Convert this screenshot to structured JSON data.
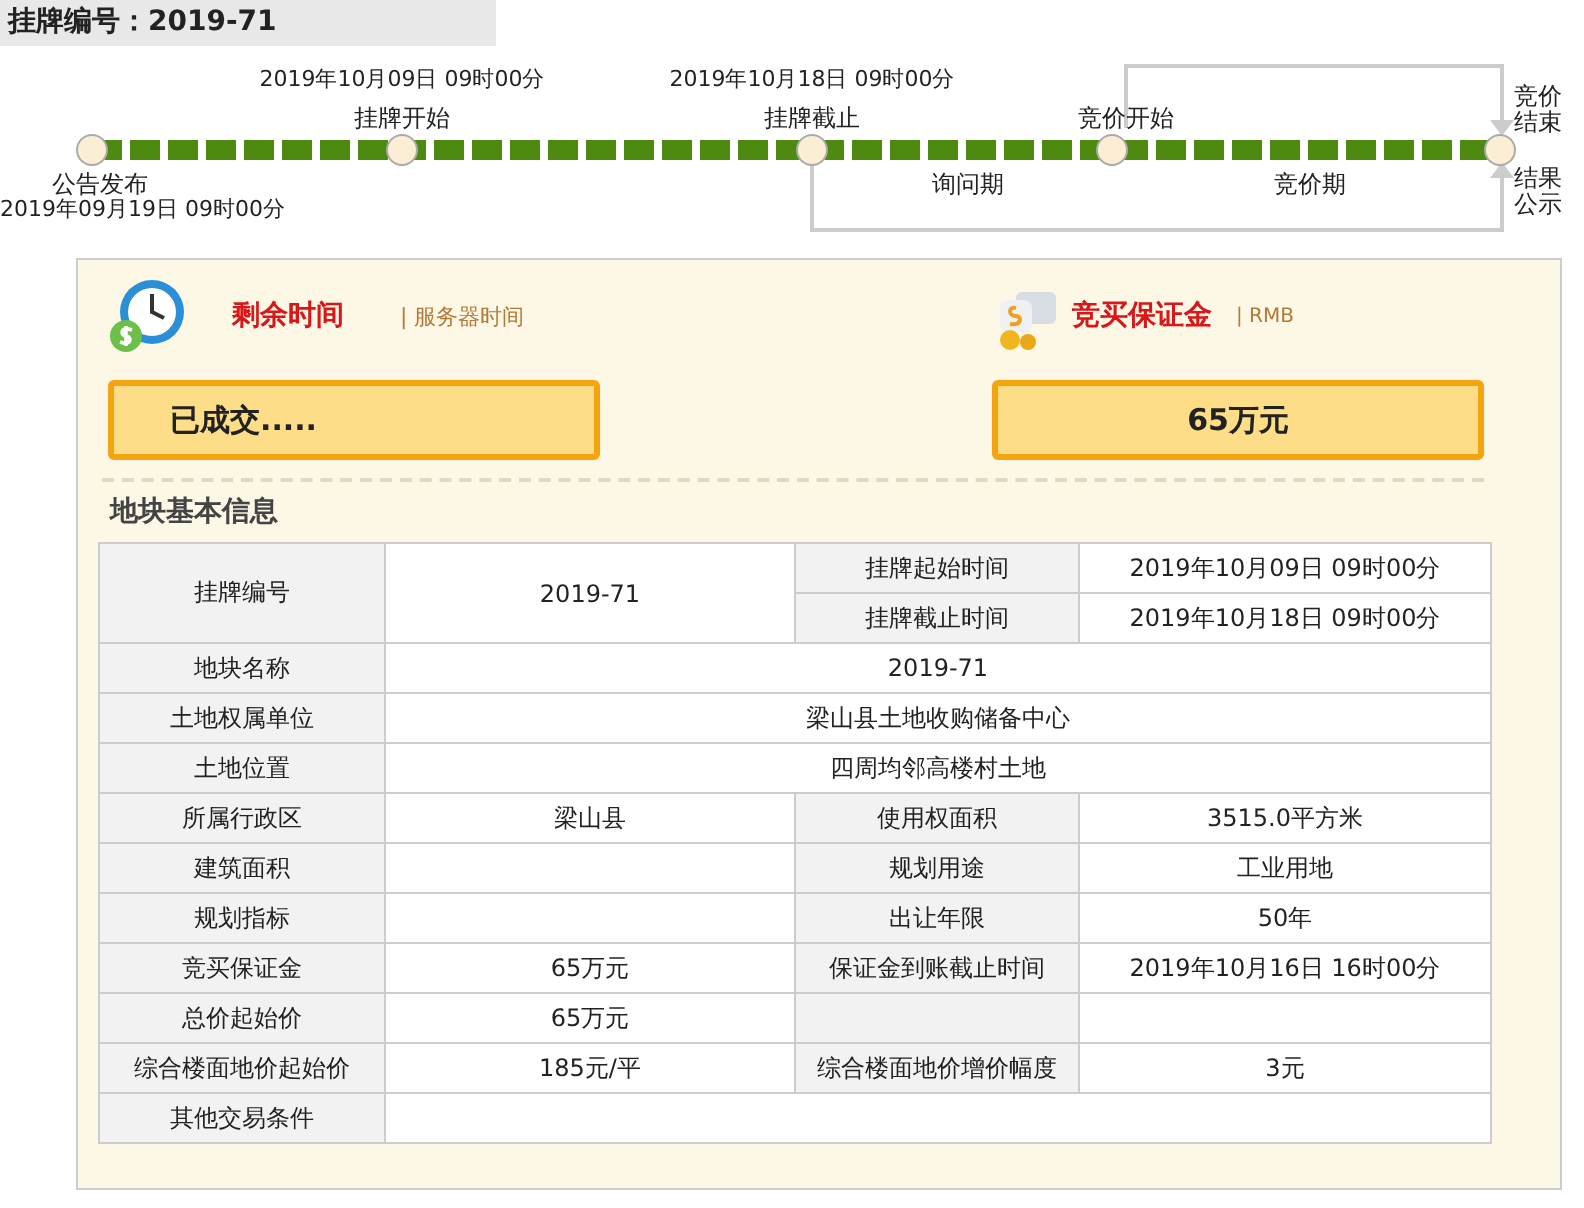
{
  "header": {
    "title": "挂牌编号：2019-71"
  },
  "timeline": {
    "milestones": [
      {
        "label": "公告发布",
        "date": "2019年09月19日 09时00分"
      },
      {
        "label": "挂牌开始",
        "date": "2019年10月09日 09时00分"
      },
      {
        "label": "挂牌截止",
        "date": "2019年10月18日 09时00分"
      },
      {
        "label": "竞价开始"
      }
    ],
    "periods": [
      "询问期",
      "竞价期"
    ],
    "end_labels": [
      "竞价结束",
      "结果公示"
    ]
  },
  "status": {
    "remaining_title": "剩余时间",
    "remaining_note": "| 服务器时间",
    "remaining_value": "已成交.....",
    "deposit_title": "竞买保证金",
    "deposit_note": "| RMB",
    "deposit_value": "65万元"
  },
  "info": {
    "title": "地块基本信息",
    "rows": [
      {
        "kind": "split",
        "label": "挂牌编号",
        "value": "2019-71",
        "sub": [
          {
            "label": "挂牌起始时间",
            "value": "2019年10月09日 09时00分"
          },
          {
            "label": "挂牌截止时间",
            "value": "2019年10月18日 09时00分"
          }
        ]
      },
      {
        "kind": "wide",
        "label": "地块名称",
        "value": "2019-71"
      },
      {
        "kind": "wide",
        "label": "土地权属单位",
        "value": "梁山县土地收购储备中心"
      },
      {
        "kind": "wide",
        "label": "土地位置",
        "value": "四周均邻高楼村土地"
      },
      {
        "kind": "pair",
        "label": "所属行政区",
        "value": "梁山县",
        "label_2": "使用权面积",
        "value_2": "3515.0平方米"
      },
      {
        "kind": "pair",
        "label": "建筑面积",
        "label_2": "规划用途",
        "value_2": "工业用地"
      },
      {
        "kind": "pair",
        "label": "规划指标",
        "label_2": "出让年限",
        "value_2": "50年"
      },
      {
        "kind": "pair",
        "label": "竞买保证金",
        "value": "65万元",
        "label_2": "保证金到账截止时间",
        "value_2": "2019年10月16日 16时00分"
      },
      {
        "kind": "pair",
        "label": "总价起始价",
        "value": "65万元"
      },
      {
        "kind": "pair",
        "label": "综合楼面地价起始价",
        "value": "185元/平",
        "label_2": "综合楼面地价增价幅度",
        "value_2": "3元"
      },
      {
        "kind": "wide",
        "label": "其他交易条件"
      }
    ]
  }
}
